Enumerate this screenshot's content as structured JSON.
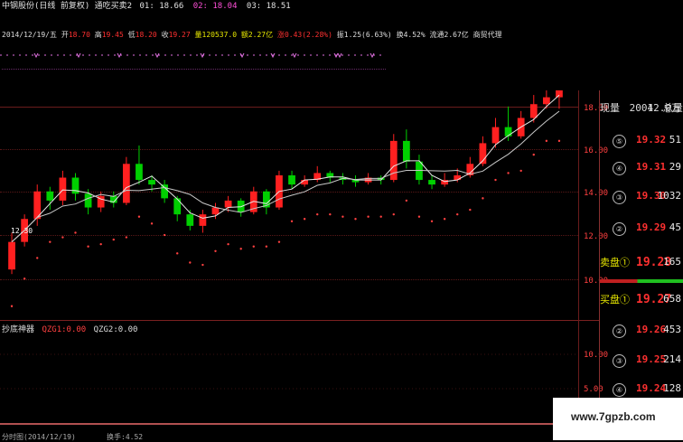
{
  "header": {
    "line1": {
      "title": "中钢股份(日线 前复权) 通吃买卖2",
      "value1": "01: 18.66",
      "value2": "02: 18.04",
      "value3": "03: 18.51"
    },
    "line2": {
      "date": "2014/12/19/五",
      "open_label": "开",
      "open": "18.70",
      "high_label": "高",
      "high": "19.45",
      "low_label": "低",
      "low": "18.20",
      "close_label": "收",
      "close": "19.27",
      "volume": "量120537.0",
      "amount": "额2.27亿",
      "change": "涨0.43(2.28%)",
      "amplitude": "振1.25(6.63%)",
      "turnover": "换4.52%",
      "float_cap": "流通2.67亿",
      "extra": "商贸代理"
    }
  },
  "sub_panel": {
    "name": "抄底神器",
    "q_label": "QZG1:",
    "q_value": "0.00",
    "q2_label": "QZG2:",
    "q2_value": "0.00"
  },
  "bottom_bar": {
    "left_text": "分时图(2014/12/19)",
    "mid_text": "换手:4.52"
  },
  "price_labels": {
    "annotation": "12.30",
    "axis": [
      "18.00",
      "16.00",
      "14.00",
      "12.00",
      "10.00"
    ],
    "sub_axis": [
      "10.00",
      "5.00"
    ]
  },
  "order_book": {
    "header": [
      "现量",
      "2004",
      "总量",
      "12.0万"
    ],
    "sell_rows": [
      {
        "idx": "⑤",
        "price": "19.32",
        "vol": "51"
      },
      {
        "idx": "④",
        "price": "19.31",
        "vol": "29"
      },
      {
        "idx": "③",
        "price": "19.30",
        "vol": "1032"
      },
      {
        "idx": "②",
        "price": "19.29",
        "vol": "45"
      }
    ],
    "sell_one": {
      "label": "卖盘①",
      "price": "19.28",
      "vol": "165"
    },
    "buy_one": {
      "label": "买盘①",
      "price": "19.27",
      "vol": "658"
    },
    "buy_rows": [
      {
        "idx": "②",
        "price": "19.26",
        "vol": "453"
      },
      {
        "idx": "③",
        "price": "19.25",
        "vol": "214"
      },
      {
        "idx": "④",
        "price": "19.24",
        "vol": "128"
      }
    ]
  },
  "watermark": "www.7gpzb.com",
  "colors": {
    "up": "#ff2020",
    "down": "#00d000",
    "ma": "#e8e8e8",
    "grid": "#5a1818",
    "signal": "#ff4040"
  },
  "chart_data": {
    "type": "candlestick",
    "ylim": [
      9,
      19
    ],
    "candles": [
      {
        "o": 11.2,
        "c": 12.4,
        "h": 12.8,
        "l": 11.0
      },
      {
        "o": 12.4,
        "c": 13.4,
        "h": 13.6,
        "l": 12.2
      },
      {
        "o": 13.4,
        "c": 14.6,
        "h": 14.9,
        "l": 13.1
      },
      {
        "o": 14.6,
        "c": 14.2,
        "h": 14.8,
        "l": 13.8
      },
      {
        "o": 14.2,
        "c": 15.2,
        "h": 15.5,
        "l": 14.0
      },
      {
        "o": 15.2,
        "c": 14.5,
        "h": 15.4,
        "l": 14.2
      },
      {
        "o": 14.5,
        "c": 13.9,
        "h": 14.7,
        "l": 13.6
      },
      {
        "o": 13.9,
        "c": 14.4,
        "h": 14.6,
        "l": 13.7
      },
      {
        "o": 14.4,
        "c": 14.1,
        "h": 14.6,
        "l": 13.9
      },
      {
        "o": 14.1,
        "c": 15.8,
        "h": 16.1,
        "l": 14.0
      },
      {
        "o": 15.8,
        "c": 15.1,
        "h": 16.6,
        "l": 14.9
      },
      {
        "o": 15.1,
        "c": 14.9,
        "h": 15.3,
        "l": 14.6
      },
      {
        "o": 14.9,
        "c": 14.3,
        "h": 15.1,
        "l": 14.1
      },
      {
        "o": 14.3,
        "c": 13.6,
        "h": 14.4,
        "l": 13.3
      },
      {
        "o": 13.6,
        "c": 13.1,
        "h": 13.8,
        "l": 12.9
      },
      {
        "o": 13.1,
        "c": 13.6,
        "h": 13.8,
        "l": 12.8
      },
      {
        "o": 13.6,
        "c": 13.9,
        "h": 14.1,
        "l": 13.4
      },
      {
        "o": 13.9,
        "c": 14.2,
        "h": 14.4,
        "l": 13.7
      },
      {
        "o": 14.2,
        "c": 13.7,
        "h": 14.3,
        "l": 13.5
      },
      {
        "o": 13.7,
        "c": 14.6,
        "h": 14.8,
        "l": 13.6
      },
      {
        "o": 14.6,
        "c": 13.9,
        "h": 14.7,
        "l": 13.6
      },
      {
        "o": 13.9,
        "c": 15.3,
        "h": 15.5,
        "l": 13.8
      },
      {
        "o": 15.3,
        "c": 14.9,
        "h": 15.5,
        "l": 14.7
      },
      {
        "o": 14.9,
        "c": 15.1,
        "h": 15.3,
        "l": 14.8
      },
      {
        "o": 15.1,
        "c": 15.4,
        "h": 15.7,
        "l": 15.0
      },
      {
        "o": 15.4,
        "c": 15.2,
        "h": 15.5,
        "l": 15.0
      },
      {
        "o": 15.2,
        "c": 15.1,
        "h": 15.4,
        "l": 14.9
      },
      {
        "o": 15.1,
        "c": 15.0,
        "h": 15.3,
        "l": 14.8
      },
      {
        "o": 15.0,
        "c": 15.2,
        "h": 15.4,
        "l": 14.9
      },
      {
        "o": 15.2,
        "c": 15.1,
        "h": 15.3,
        "l": 14.9
      },
      {
        "o": 15.1,
        "c": 16.8,
        "h": 17.1,
        "l": 15.0
      },
      {
        "o": 16.8,
        "c": 15.9,
        "h": 17.3,
        "l": 15.6
      },
      {
        "o": 15.9,
        "c": 15.1,
        "h": 16.2,
        "l": 14.9
      },
      {
        "o": 15.1,
        "c": 14.9,
        "h": 15.3,
        "l": 14.7
      },
      {
        "o": 14.9,
        "c": 15.1,
        "h": 15.4,
        "l": 14.8
      },
      {
        "o": 15.1,
        "c": 15.3,
        "h": 15.6,
        "l": 15.0
      },
      {
        "o": 15.3,
        "c": 15.8,
        "h": 16.1,
        "l": 15.2
      },
      {
        "o": 15.8,
        "c": 16.7,
        "h": 17.0,
        "l": 15.7
      },
      {
        "o": 16.7,
        "c": 17.4,
        "h": 17.8,
        "l": 16.5
      },
      {
        "o": 17.4,
        "c": 17.0,
        "h": 18.3,
        "l": 16.8
      },
      {
        "o": 17.0,
        "c": 17.8,
        "h": 18.1,
        "l": 16.9
      },
      {
        "o": 17.8,
        "c": 18.4,
        "h": 18.8,
        "l": 17.6
      },
      {
        "o": 18.4,
        "c": 18.7,
        "h": 19.2,
        "l": 18.2
      },
      {
        "o": 18.7,
        "c": 19.27,
        "h": 19.45,
        "l": 18.2
      }
    ]
  }
}
